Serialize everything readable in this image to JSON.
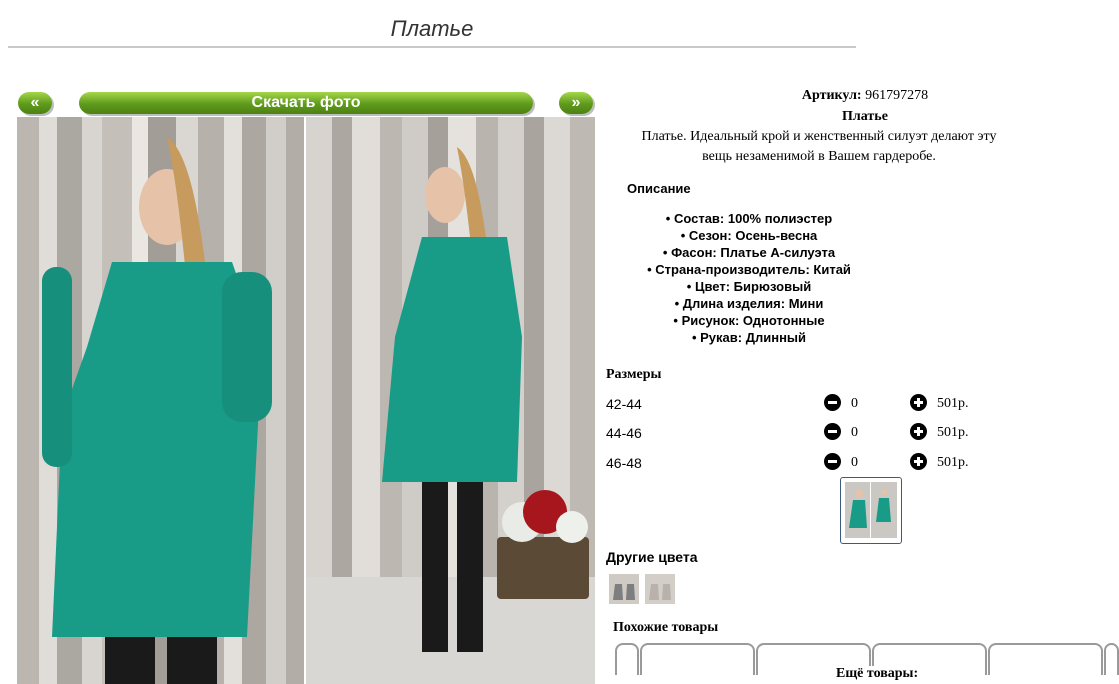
{
  "page": {
    "title": "Платье"
  },
  "gallery": {
    "prev_label": "«",
    "next_label": "»",
    "download_label": "Скачать фото"
  },
  "product": {
    "article_label": "Артикул:",
    "article_value": "961797278",
    "name": "Платье",
    "short_description": "Платье. Идеальный крой и женственный силуэт делают эту вещь незаменимой в Вашем гардеробе."
  },
  "description": {
    "heading": "Описание",
    "properties": [
      "Состав: 100% полиэстер",
      "Сезон: Осень-весна",
      "Фасон: Платье А-силуэта",
      "Страна-производитель: Китай",
      "Цвет: Бирюзовый",
      "Длина изделия: Мини",
      "Рисунок: Однотонные",
      "Рукав: Длинный"
    ]
  },
  "sizes": {
    "heading": "Размеры",
    "rows": [
      {
        "size": "42-44",
        "qty": "0",
        "price": "501р."
      },
      {
        "size": "44-46",
        "qty": "0",
        "price": "501р."
      },
      {
        "size": "46-48",
        "qty": "0",
        "price": "501р."
      }
    ]
  },
  "other_colors": {
    "heading": "Другие цвета"
  },
  "similar": {
    "heading": "Похожие товары",
    "more_label": "Ещё товары:"
  },
  "colors": {
    "dress": "#189c88",
    "button_green": "#6aa824",
    "thumb_border": "#3b5b7a"
  }
}
